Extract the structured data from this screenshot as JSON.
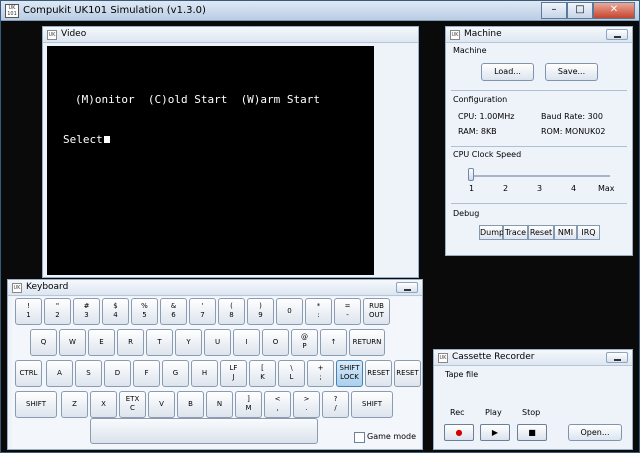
{
  "app": {
    "title": "Compukit UK101 Simulation (v1.3.0)",
    "icon_text": "UK\n101",
    "window_buttons": {
      "minimize": "–",
      "maximize": "□",
      "close": "✕"
    }
  },
  "video": {
    "title": "Video",
    "line1": "(M)onitor  (C)old Start  (W)arm Start",
    "line2": "Select"
  },
  "machine": {
    "title": "Machine",
    "section_machine": "Machine",
    "load_label": "Load...",
    "save_label": "Save...",
    "section_configuration": "Configuration",
    "cpu": "CPU: 1.00MHz",
    "baud": "Baud Rate: 300",
    "ram": "RAM: 8KB",
    "rom": "ROM: MONUK02",
    "section_clock": "CPU Clock Speed",
    "clock_ticks": [
      "1",
      "2",
      "3",
      "4",
      "Max"
    ],
    "clock_value": "1",
    "section_debug": "Debug",
    "debug_buttons": [
      "Dump",
      "Trace",
      "Reset",
      "NMI",
      "IRQ"
    ]
  },
  "keyboard": {
    "title": "Keyboard",
    "row1": [
      "!\n1",
      "\"\n2",
      "#\n3",
      "$\n4",
      "%\n5",
      "&\n6",
      "'\n7",
      "(\n8",
      ")\n9",
      "0",
      "*\n:",
      "=\n-",
      "RUB\nOUT"
    ],
    "row2": [
      "Q",
      "W",
      "E",
      "R",
      "T",
      "Y",
      "U",
      "I",
      "O",
      "@\nP",
      "↑",
      "RETURN"
    ],
    "row3": [
      "CTRL",
      "A",
      "S",
      "D",
      "F",
      "G",
      "H",
      "LF\nJ",
      "[\nK",
      "\\\nL",
      "+\n;",
      "SHIFT\nLOCK",
      "RESET",
      "RESET"
    ],
    "row4": [
      "SHIFT",
      "Z",
      "X",
      "ETX\nC",
      "V",
      "B",
      "N",
      "]\nM",
      "<\n,",
      ">\n.",
      "?\n/",
      "SHIFT"
    ],
    "game_mode_label": "Game mode",
    "game_mode_checked": false
  },
  "cassette": {
    "title": "Cassette Recorder",
    "tape_file_label": "Tape file",
    "rec_label": "Rec",
    "play_label": "Play",
    "stop_label": "Stop",
    "rec_icon": "●",
    "play_icon": "▶",
    "stop_icon": "■",
    "open_label": "Open...",
    "rec_color": "#d40000"
  }
}
